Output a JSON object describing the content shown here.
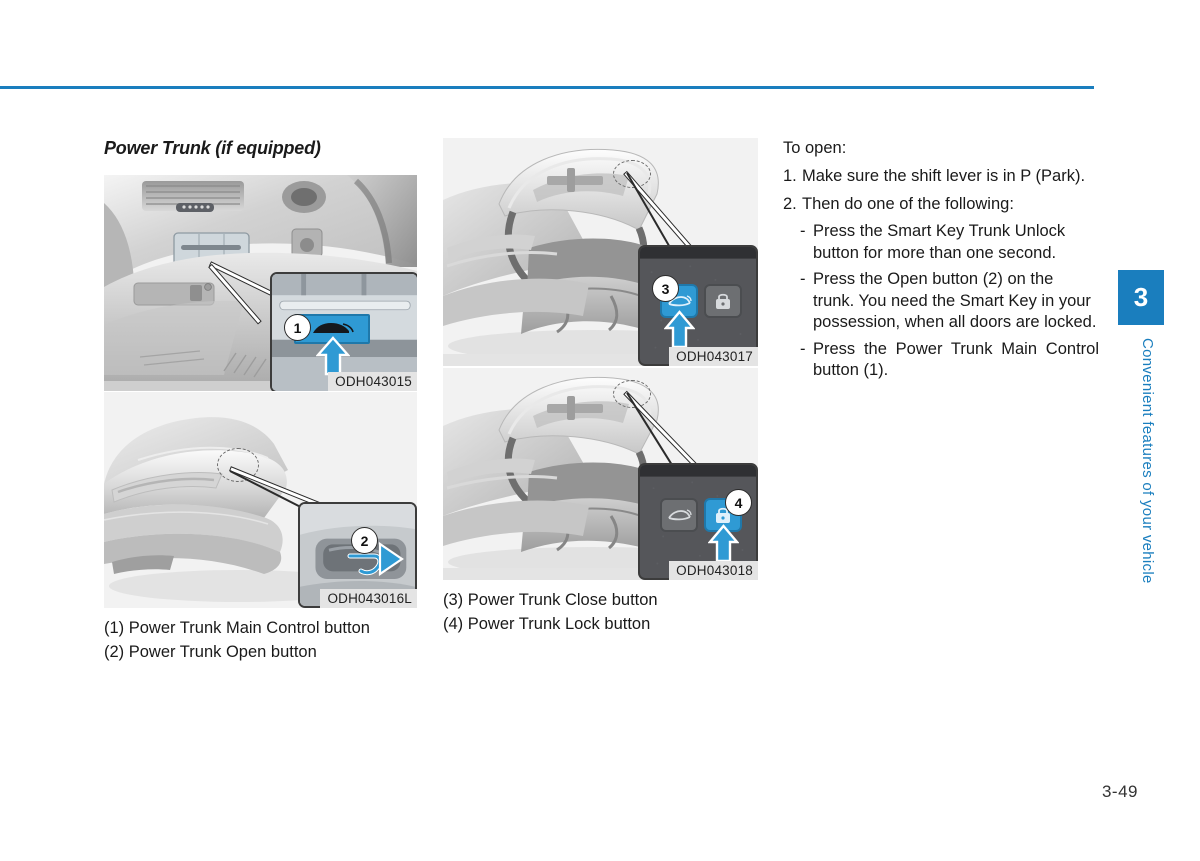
{
  "page": {
    "number": "3-49",
    "accent_color": "#1a7ebe",
    "rule_color": "#1a7ebe"
  },
  "side_tab": {
    "chapter_number": "3",
    "chapter_title": "Convenient features of your vehicle"
  },
  "section": {
    "title": "Power Trunk (if equipped)"
  },
  "figures": [
    {
      "id": "fig-dashboard",
      "code": "ODH043015",
      "description": "Interior dashboard view with power trunk main control button",
      "callout": "1",
      "inset_icon": "car-trunk-open-icon",
      "pointer_icon": "up-arrow-icon"
    },
    {
      "id": "fig-rear-exterior",
      "code": "ODH043016L",
      "description": "Rear exterior of sedan with trunk open button on trunk lid",
      "callout": "2",
      "inset_icon": "trunk-handle-icon",
      "pointer_icon": "curved-arrow-icon"
    },
    {
      "id": "fig-trunk-close",
      "code": "ODH043017",
      "description": "Open trunk with power trunk close button panel",
      "callout": "3",
      "inset_icon": "car-trunk-close-icon",
      "secondary_icon": "lock-icon",
      "pointer_icon": "up-arrow-icon"
    },
    {
      "id": "fig-trunk-lock",
      "code": "ODH043018",
      "description": "Open trunk with power trunk lock button panel",
      "callout": "4",
      "inset_icon": "car-trunk-close-icon",
      "secondary_icon": "lock-icon",
      "pointer_icon": "up-arrow-icon"
    }
  ],
  "captions_left": [
    "(1) Power Trunk Main Control button",
    "(2) Power Trunk Open button"
  ],
  "captions_middle": [
    "(3) Power Trunk Close button",
    "(4) Power Trunk Lock button"
  ],
  "instructions": {
    "heading": "To open:",
    "steps": [
      {
        "num": "1.",
        "text": "Make sure the shift lever is in P (Park)."
      },
      {
        "num": "2.",
        "text": "Then do one of the following:"
      }
    ],
    "bullets": [
      {
        "dash": "-",
        "text": "Press the Smart Key Trunk Unlock button for more than one second."
      },
      {
        "dash": "-",
        "text": "Press the Open button (2) on the trunk. You need the Smart Key in your possession, when all doors are locked."
      },
      {
        "dash": "-",
        "text": "Press the Power Trunk Main Control button (1)."
      }
    ]
  }
}
